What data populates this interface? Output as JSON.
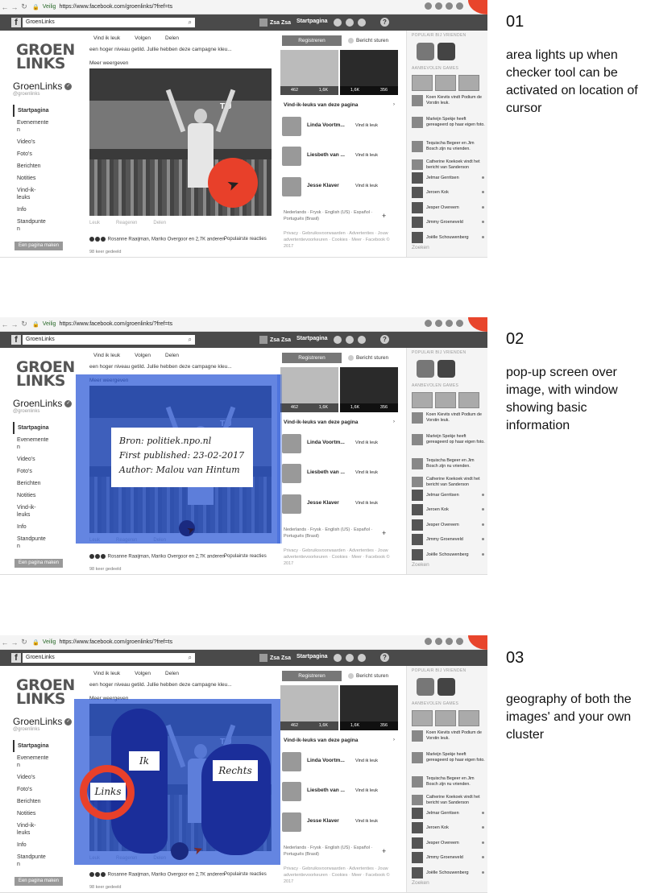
{
  "browser": {
    "secure_label": "Veilig",
    "url": "https://www.facebook.com/groenlinks/?fref=ts"
  },
  "facebook": {
    "search_value": "GroenLinks",
    "user_name": "Zsa Zsa",
    "home_label": "Startpagina"
  },
  "page": {
    "brand_line1": "GROEN",
    "brand_line2": "LINKS",
    "name": "GroenLinks",
    "handle": "@groenlinks",
    "nav": [
      "Startpagina",
      "Evenemente\nn",
      "Video's",
      "Foto's",
      "Berichten",
      "Notities",
      "Vind-ik-\nleuks",
      "Info",
      "Standpunte\nn"
    ],
    "create_page_button": "Een pagina maken"
  },
  "post": {
    "actions": [
      "Vind ik leuk",
      "Volgen",
      "Delen"
    ],
    "description": "een hoger niveau getild. Jullie hebben deze campagne kleu...",
    "more_link": "Meer weergeven",
    "photo_sign": "TIJ",
    "reactions": [
      "Leuk",
      "Reageren",
      "Delen"
    ],
    "reaction_summary": "Rosanne Raaijman, Mariko Overgoor en 2,7K anderen",
    "popular_reactions": "Populairste reacties",
    "time_ago": "98 keer gedeeld"
  },
  "right": {
    "register_button": "Registreren",
    "message_button": "Bericht sturen",
    "thumb1_stats": [
      "462",
      "1,6K"
    ],
    "thumb2_stats": [
      "1,6K",
      "356"
    ],
    "likes_heading": "Vind-ik-leuks van deze pagina",
    "like_people": [
      {
        "name": "Linda Voortm...",
        "action": "Vind ik leuk"
      },
      {
        "name": "Liesbeth van ...",
        "action": "Vind ik leuk"
      },
      {
        "name": "Jesse Klaver",
        "action": "Vind ik leuk"
      }
    ],
    "languages": "Nederlands · Frysk · English (US) · Español · Português (Brasil)",
    "footer": "Privacy · Gebruiksvoorwaarden · Advertenties · Jouw advertentievoorkeuren · Cookies · Meer · Facebook © 2017"
  },
  "sidebar": {
    "popular_heading": "POPULAIR BIJ VRIENDEN",
    "games_heading": "AANBEVOLEN GAMES",
    "activity": [
      "Koen Kievits vindt Podium de Vorstin leuk.",
      "Marleijn Spekje heeft gereageerd op haar eigen foto.",
      "Tequischa Begeer en Jim Bosch zijn nu vrienden.",
      "Catherine Koekoek vindt het bericht van Sanderson"
    ],
    "friends": [
      "Jelmar Gerritsen",
      "Jeroen Kok",
      "Jesper Overeem",
      "Jimmy Groeneveld",
      "Joëlle Schouwenberg"
    ],
    "search_placeholder": "Zoeken"
  },
  "overlay2": {
    "info_lines": [
      "Bron: politiek.npo.nl",
      "First published: 23-02-2017",
      "Author: Malou van Hintum"
    ]
  },
  "overlay3": {
    "tags": [
      "Ik",
      "Links",
      "Rechts"
    ]
  },
  "steps": [
    {
      "number": "01",
      "text": "area lights up when checker tool can be activated on location of cursor"
    },
    {
      "number": "02",
      "text": "pop-up screen over image, with window showing basic information"
    },
    {
      "number": "03",
      "text": "geography of both the images' and your own cluster"
    }
  ],
  "colors": {
    "accent_red": "#e8402a",
    "overlay_blue": "#2856d6",
    "cluster_blue": "#1b2e9a"
  }
}
